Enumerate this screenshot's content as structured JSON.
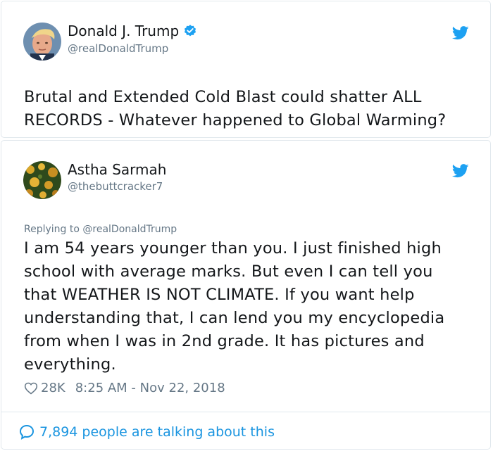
{
  "tweets": [
    {
      "author_name": "Donald J. Trump",
      "author_handle": "@realDonaldTrump",
      "verified": true,
      "avatar_icon": "portrait-avatar",
      "text": "Brutal and Extended Cold Blast could shatter ALL RECORDS - Whatever happened to Global Warming?"
    },
    {
      "author_name": "Astha Sarmah",
      "author_handle": "@thebuttcracker7",
      "verified": false,
      "avatar_icon": "flowers-avatar",
      "replying_to": "Replying to @realDonaldTrump",
      "text": "I am 54 years younger than you. I just finished high school with average marks. But even I can tell you that  WEATHER IS NOT CLIMATE. If you want help understanding that, I can lend you my encyclopedia from when I was in 2nd grade. It has pictures and everything.",
      "likes": "28K",
      "timestamp": "8:25 AM - Nov 22, 2018",
      "talking": "7,894 people are talking about this"
    }
  ],
  "icons": {
    "brand": "twitter-bird-icon",
    "verified": "verified-badge-icon",
    "like": "heart-icon",
    "reply": "speech-bubble-icon"
  },
  "colors": {
    "twitter_blue": "#1da1f2",
    "link_blue": "#1b95e0",
    "secondary_text": "#657786",
    "border": "#e1e8ed"
  }
}
